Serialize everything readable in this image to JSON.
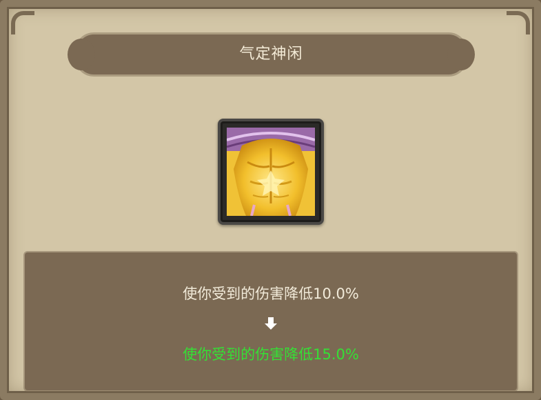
{
  "dialog": {
    "title": "气定神闲",
    "skill_icon": "golden-muscle-body-icon",
    "effect_current": "使你受到的伤害降低10.0%",
    "effect_next": "使你受到的伤害降低15.0%",
    "arrow_icon": "down-arrow-icon"
  },
  "colors": {
    "panel_bg": "#d3c6a7",
    "banner_bg": "#7b6953",
    "text_light": "#f1ead9",
    "text_upgrade": "#35e035"
  }
}
